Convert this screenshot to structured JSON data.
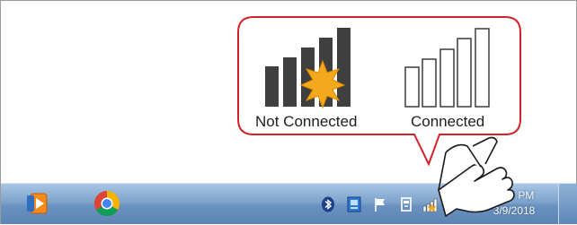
{
  "callout": {
    "not_connected_label": "Not Connected",
    "connected_label": "Connected",
    "outline_color": "#d2232a"
  },
  "taskbar": {
    "pinned": [
      {
        "name": "media-player-icon"
      },
      {
        "name": "chrome-icon"
      }
    ],
    "tray_icons": [
      "bluetooth-icon",
      "network-app-icon",
      "action-center-flag-icon",
      "device-icon",
      "signal-not-connected-icon",
      "speaker-icon"
    ],
    "clock": {
      "time": "3:46 PM",
      "date": "3/9/2018"
    }
  }
}
